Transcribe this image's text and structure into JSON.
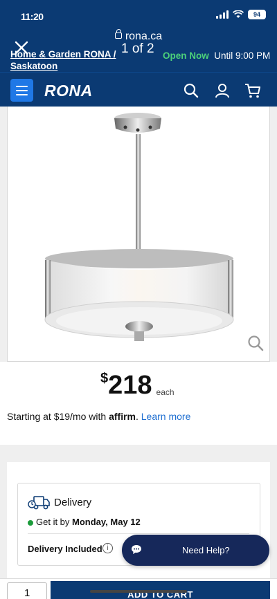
{
  "status_bar": {
    "time": "11:20",
    "battery": "94"
  },
  "browser": {
    "domain": "rona.ca",
    "close_label": "close"
  },
  "store": {
    "name": "Home & Garden RONA / Saskatoon",
    "gallery_counter": "1 of 2",
    "open_status": "Open Now",
    "hours": "Until 9:00 PM"
  },
  "nav": {
    "logo": "RONA"
  },
  "product": {
    "currency": "$",
    "price": "218",
    "unit": "each",
    "financing_prefix": "Starting at $19/mo with ",
    "financing_brand": "affirm",
    "financing_link": "Learn more"
  },
  "delivery": {
    "title": "Delivery",
    "get_it_prefix": "Get it by ",
    "date": "Monday, May 12",
    "included": "Delivery Included",
    "info_glyph": "i"
  },
  "help": {
    "label": "Need Help?"
  },
  "cart": {
    "quantity": "1",
    "add_label": "ADD TO CART"
  },
  "colors": {
    "brand_blue": "#0b3a73",
    "accent_blue": "#1f78e6",
    "open_green": "#4cd07a",
    "help_navy": "#16285a"
  }
}
